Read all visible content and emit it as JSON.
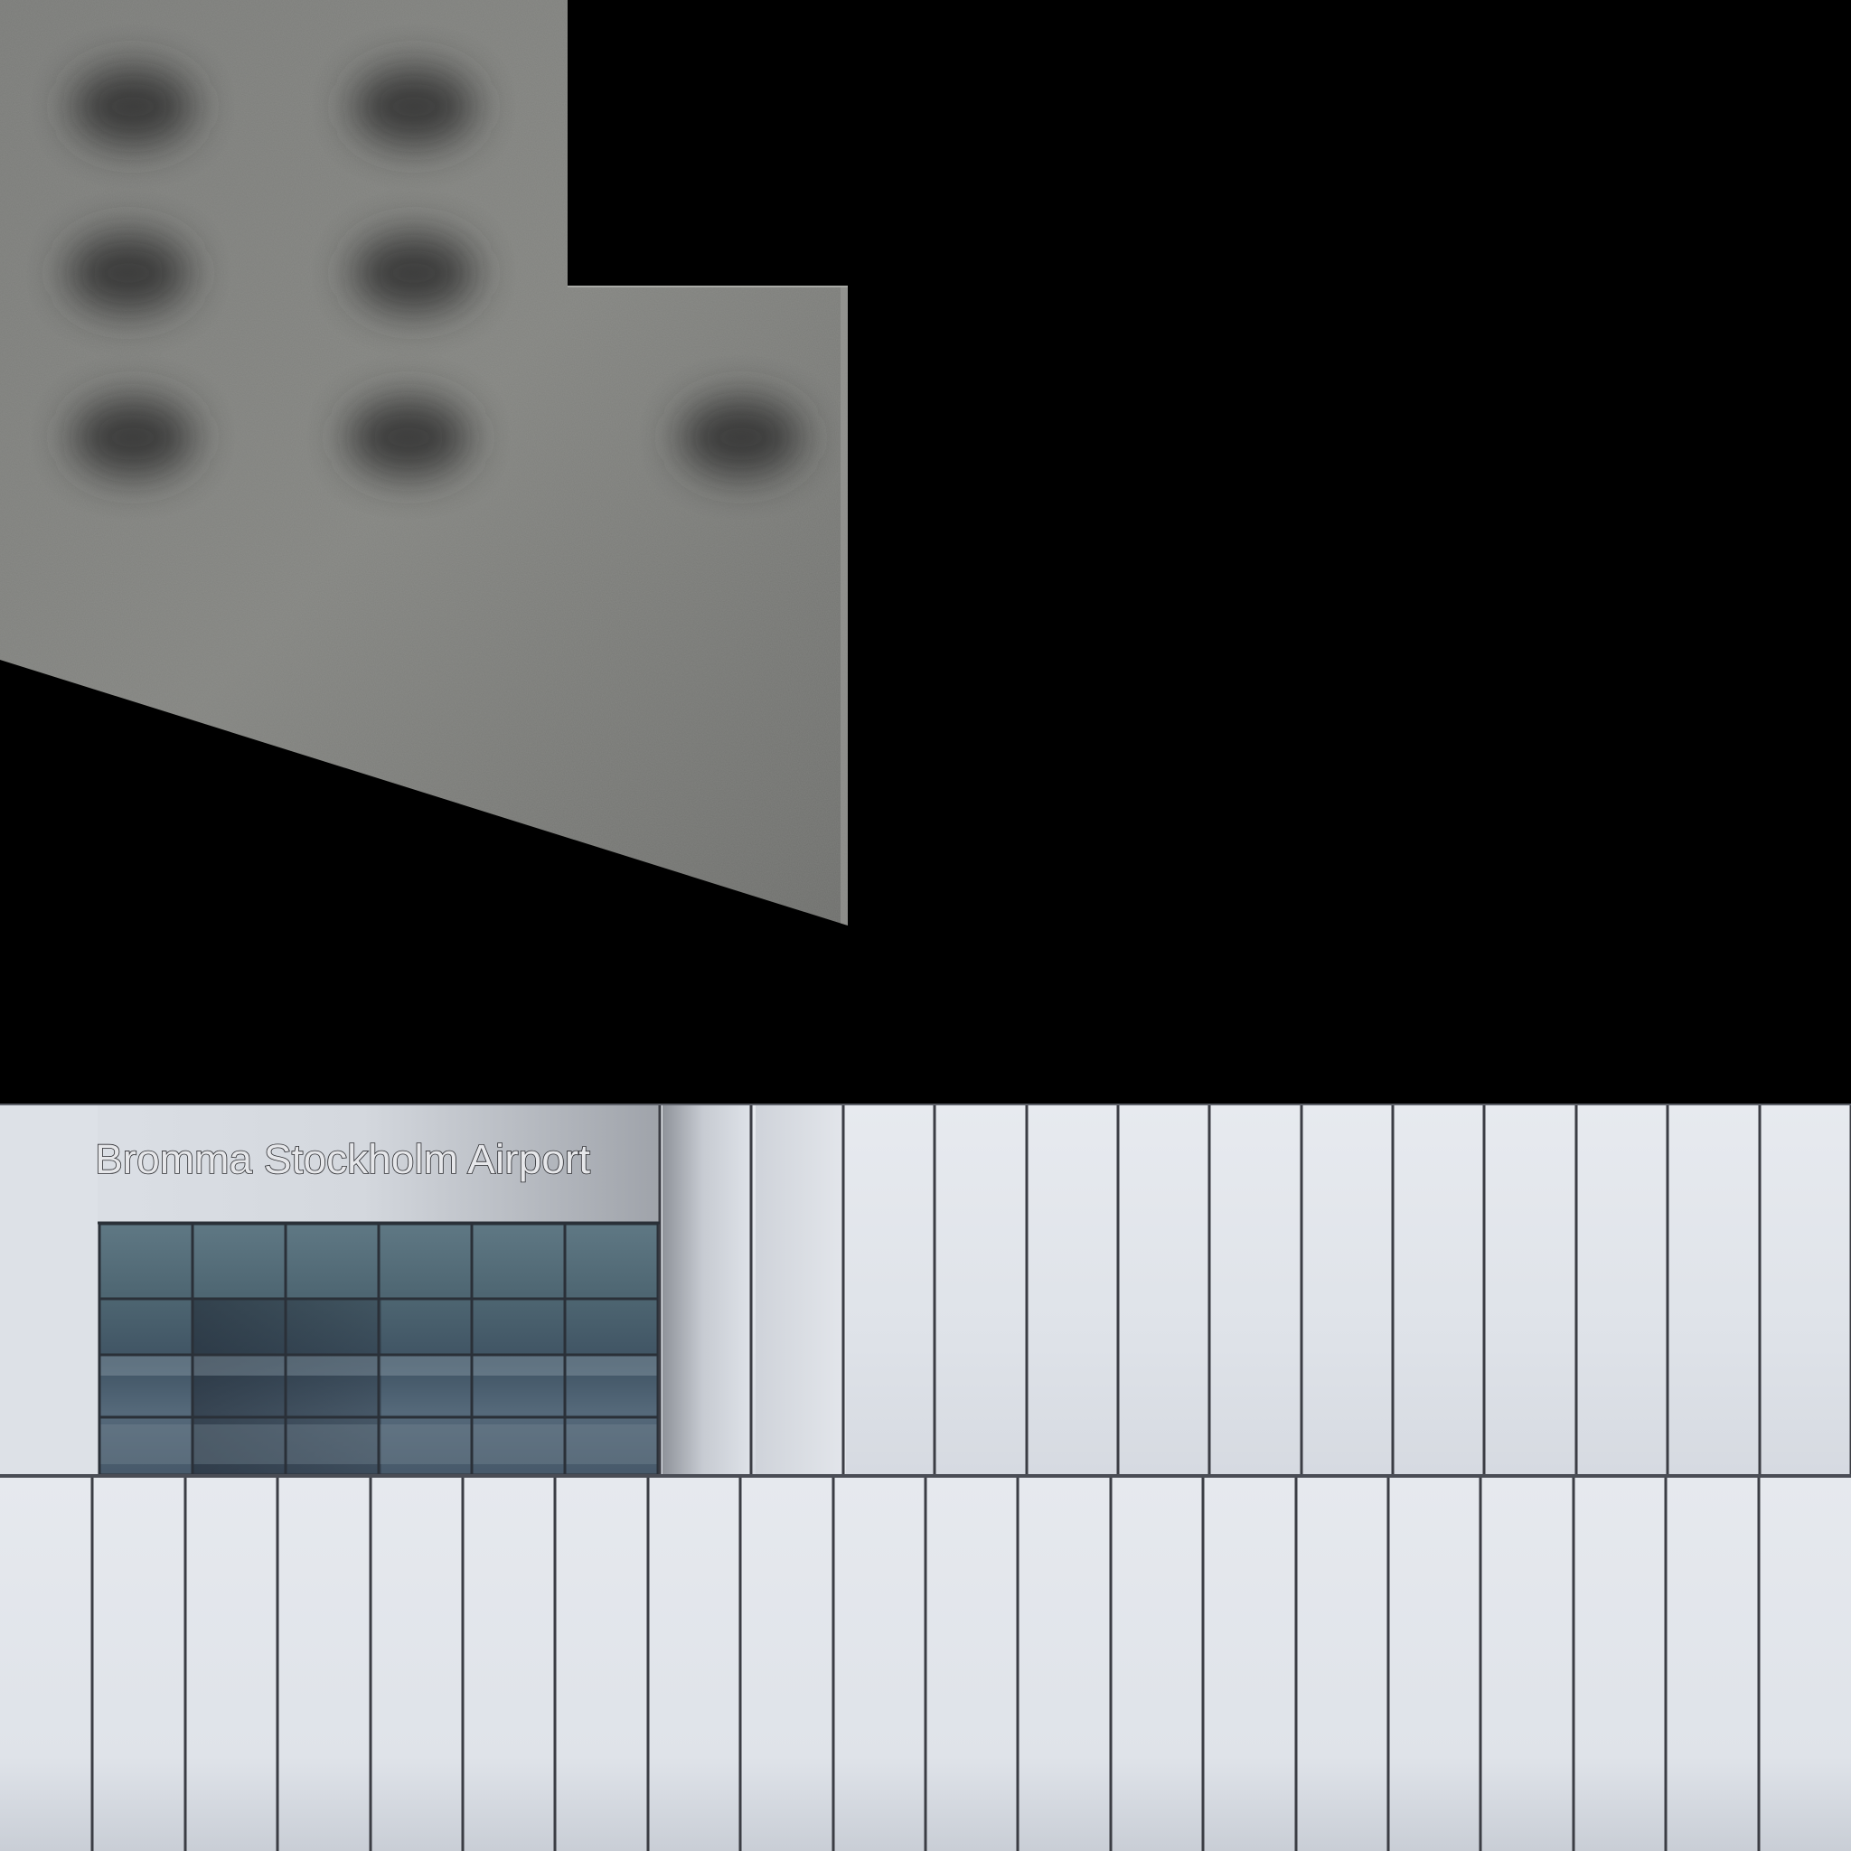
{
  "atlas": {
    "background_color": "#000000",
    "roof_texture": {
      "base_color": "#7e7f7c",
      "shadow_color": "#2e2f2d",
      "vent_shadow_count": 7
    },
    "facade_texture": {
      "panel_color": "#dfe3e9",
      "seam_color": "#3b3d44",
      "sign": {
        "text": "Bromma Stockholm Airport",
        "fill_color": "#e6e7ea",
        "outline_color": "#2c2d31"
      },
      "glazing": {
        "glass_color": "#4e6774",
        "mullion_color": "#2a3038",
        "column_count": 6,
        "row_count": 4
      },
      "upper_band_panel_count": 13,
      "lower_band_panel_count": 20
    }
  }
}
